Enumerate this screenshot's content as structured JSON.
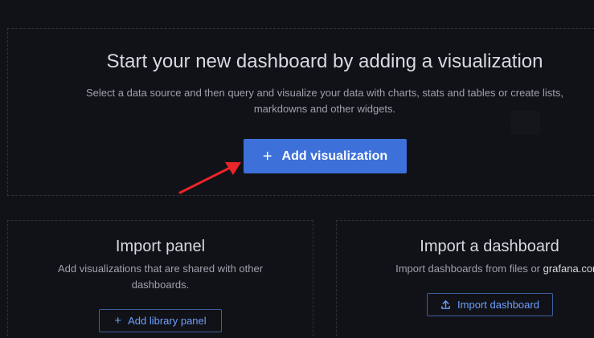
{
  "hero": {
    "title": "Start your new dashboard by adding a visualization",
    "description_line1": "Select a data source and then query and visualize your data with charts, stats and tables or create lists,",
    "description_line2": "markdowns and other widgets.",
    "add_visualization_label": "Add visualization",
    "plus_glyph": "+"
  },
  "import_panel": {
    "title": "Import panel",
    "description_line1": "Add visualizations that are shared with other",
    "description_line2": "dashboards.",
    "button_label": "Add library panel",
    "plus_glyph": "+"
  },
  "import_dashboard": {
    "title": "Import a dashboard",
    "description_prefix": "Import dashboards from files or ",
    "description_link": "grafana.com",
    "button_label": "Import dashboard"
  },
  "icons": {
    "plus": "plus-icon",
    "upload": "upload-icon",
    "annotation_arrow": "annotation-arrow-icon"
  },
  "colors": {
    "background": "#111217",
    "primary_button": "#3d71d9",
    "link_text": "#6e9fff",
    "annotation_arrow": "#e8252a"
  }
}
